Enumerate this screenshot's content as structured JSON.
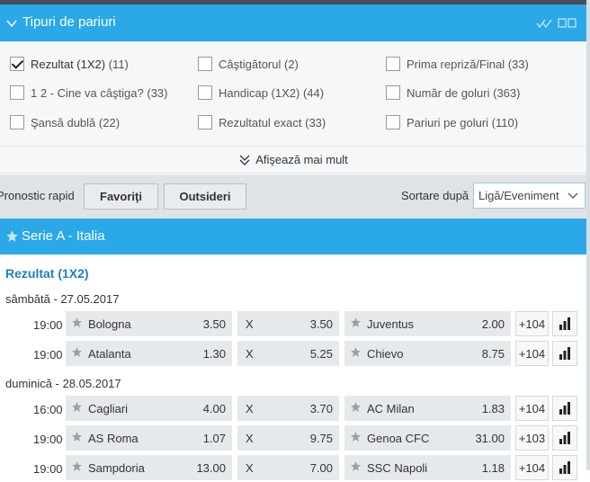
{
  "bet_types": {
    "title": "Tipuri de pariuri",
    "items": [
      {
        "label": "Rezultat (1X2)",
        "count": "(11)",
        "checked": true
      },
      {
        "label": "Câştigătorul",
        "count": "(2)",
        "checked": false
      },
      {
        "label": "Prima repriză/Final",
        "count": "(33)",
        "checked": false
      },
      {
        "label": "1 2 - Cine va câştiga?",
        "count": "(33)",
        "checked": false
      },
      {
        "label": "Handicap (1X2)",
        "count": "(44)",
        "checked": false
      },
      {
        "label": "Număr de goluri",
        "count": "(363)",
        "checked": false
      },
      {
        "label": "Şansă dublă",
        "count": "(22)",
        "checked": false
      },
      {
        "label": "Rezultatul exact",
        "count": "(33)",
        "checked": false
      },
      {
        "label": "Pariuri pe goluri",
        "count": "(110)",
        "checked": false
      }
    ],
    "show_more": "Afişează mai mult"
  },
  "toolbar": {
    "quick_label": "Pronostic rapid",
    "favorites": "Favoriţi",
    "outsiders": "Outsideri",
    "sort_label": "Sortare după",
    "sort_value": "Ligă/Eveniment"
  },
  "league": {
    "name": "Serie A - Italia",
    "market": "Rezultat (1X2)",
    "days": [
      {
        "date": "sâmbătă - 27.05.2017",
        "matches": [
          {
            "time": "19:00",
            "home": "Bologna",
            "home_odd": "3.50",
            "draw_label": "X",
            "draw_odd": "3.50",
            "away": "Juventus",
            "away_odd": "2.00",
            "more": "+104"
          },
          {
            "time": "19:00",
            "home": "Atalanta",
            "home_odd": "1.30",
            "draw_label": "X",
            "draw_odd": "5.25",
            "away": "Chievo",
            "away_odd": "8.75",
            "more": "+104"
          }
        ]
      },
      {
        "date": "duminică - 28.05.2017",
        "matches": [
          {
            "time": "16:00",
            "home": "Cagliari",
            "home_odd": "4.00",
            "draw_label": "X",
            "draw_odd": "3.70",
            "away": "AC Milan",
            "away_odd": "1.83",
            "more": "+104"
          },
          {
            "time": "19:00",
            "home": "AS Roma",
            "home_odd": "1.07",
            "draw_label": "X",
            "draw_odd": "9.75",
            "away": "Genoa CFC",
            "away_odd": "31.00",
            "more": "+103"
          },
          {
            "time": "19:00",
            "home": "Sampdoria",
            "home_odd": "13.00",
            "draw_label": "X",
            "draw_odd": "7.00",
            "away": "SSC Napoli",
            "away_odd": "1.18",
            "more": "+104"
          }
        ]
      }
    ]
  },
  "colors": {
    "header_blue": "#2aa8e8",
    "market_blue": "#1e7fc0",
    "toolbar_grey": "#dfe3e6",
    "cell_grey": "#e6e9ec"
  },
  "icons": [
    "chevron-down-icon",
    "fold-icon",
    "layout-icon",
    "checkbox-icon",
    "double-chevron-down-icon",
    "star-icon",
    "stats-icon"
  ]
}
